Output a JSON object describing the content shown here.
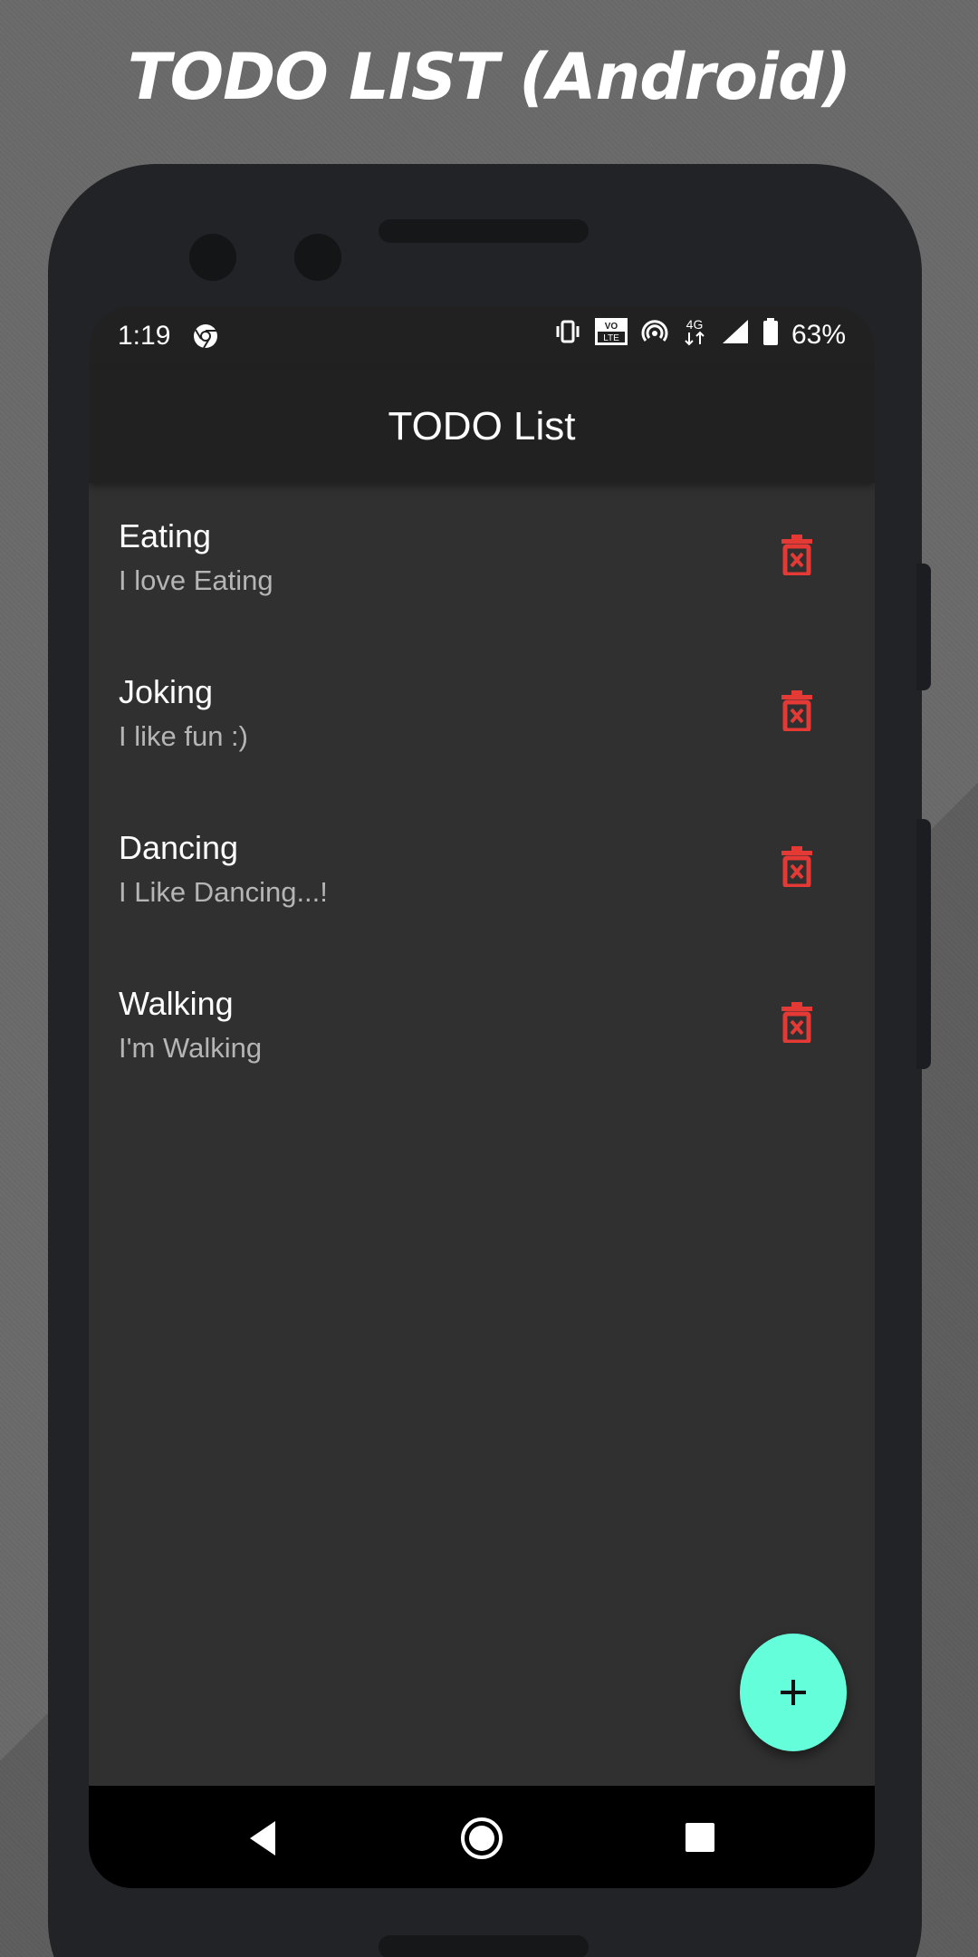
{
  "promo": {
    "title": "TODO LIST (Android)"
  },
  "status_bar": {
    "time": "1:19",
    "battery_percent": "63%",
    "network": "4G",
    "icons": [
      "chrome-icon",
      "vibrate-icon",
      "volte-icon",
      "hotspot-icon",
      "4g-icon",
      "signal-icon",
      "battery-icon"
    ]
  },
  "app_bar": {
    "title": "TODO List"
  },
  "todos": [
    {
      "title": "Eating",
      "description": "I love Eating"
    },
    {
      "title": "Joking",
      "description": "I like fun :)"
    },
    {
      "title": "Dancing",
      "description": "I Like Dancing...!"
    },
    {
      "title": "Walking",
      "description": "I'm Walking"
    }
  ],
  "fab": {
    "icon": "plus-icon"
  },
  "nav_bar": {
    "icons": [
      "back-icon",
      "home-icon",
      "recents-icon"
    ]
  },
  "colors": {
    "background": "#303030",
    "app_bar": "#212121",
    "delete_icon": "#e53935",
    "fab": "#64ffda",
    "title_text": "#ffffff",
    "subtitle_text": "#b5b5b5"
  }
}
